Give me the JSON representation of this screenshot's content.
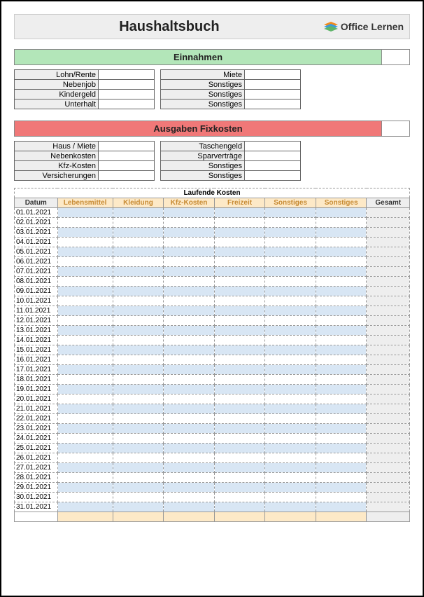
{
  "header": {
    "title": "Haushaltsbuch",
    "logo_text": "Office Lernen"
  },
  "income": {
    "section_title": "Einnahmen",
    "left_labels": [
      "Lohn/Rente",
      "Nebenjob",
      "Kindergeld",
      "Unterhalt"
    ],
    "right_labels": [
      "Miete",
      "Sonstiges",
      "Sonstiges",
      "Sonstiges"
    ]
  },
  "fixed": {
    "section_title": "Ausgaben Fixkosten",
    "left_labels": [
      "Haus / Miete",
      "Nebenkosten",
      "Kfz-Kosten",
      "Versicherungen"
    ],
    "right_labels": [
      "Taschengeld",
      "Sparverträge",
      "Sonstiges",
      "Sonstiges"
    ]
  },
  "running": {
    "section_title": "Laufende Kosten",
    "date_header": "Datum",
    "total_header": "Gesamt",
    "categories": [
      "Lebensmittel",
      "Kleidung",
      "Kfz-Kosten",
      "Freizeit",
      "Sonstiges",
      "Sonstiges"
    ],
    "dates": [
      "01.01.2021",
      "02.01.2021",
      "03.01.2021",
      "04.01.2021",
      "05.01.2021",
      "06.01.2021",
      "07.01.2021",
      "08.01.2021",
      "09.01.2021",
      "10.01.2021",
      "11.01.2021",
      "12.01.2021",
      "13.01.2021",
      "14.01.2021",
      "15.01.2021",
      "16.01.2021",
      "17.01.2021",
      "18.01.2021",
      "19.01.2021",
      "20.01.2021",
      "21.01.2021",
      "22.01.2021",
      "23.01.2021",
      "24.01.2021",
      "25.01.2021",
      "26.01.2021",
      "27.01.2021",
      "28.01.2021",
      "29.01.2021",
      "30.01.2021",
      "31.01.2021"
    ]
  }
}
